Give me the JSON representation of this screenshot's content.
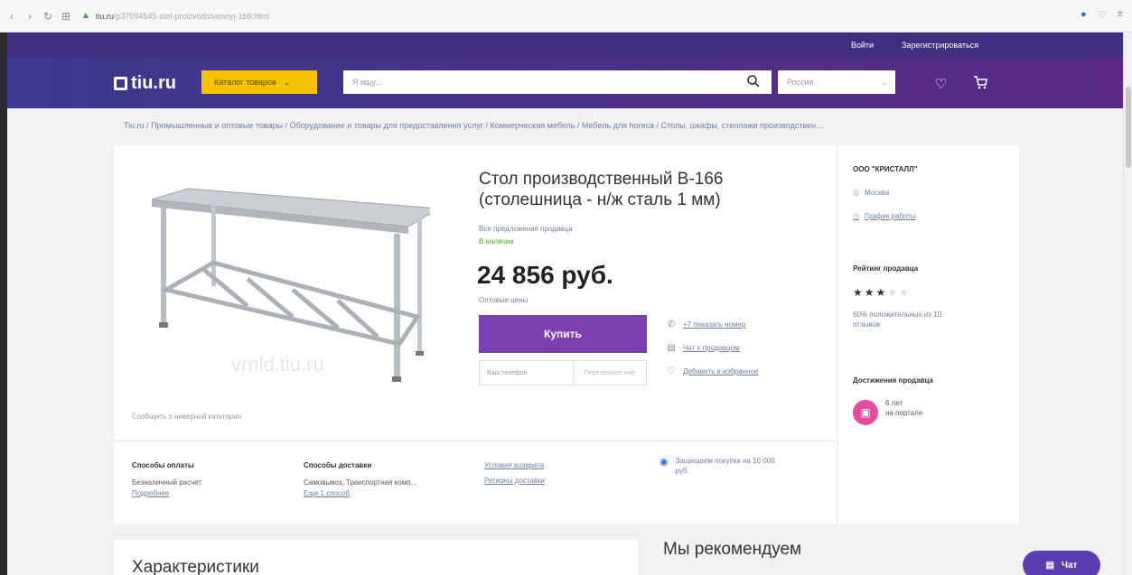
{
  "browser": {
    "url_domain": "tiu.ru",
    "url_rest": "/p37094545-stol-proizvodstvennyj-166.html"
  },
  "header": {
    "login": "Войти",
    "register": "Зарегистрироваться",
    "logo_text": "tiu.ru",
    "catalog_label": "Каталог товаров",
    "search_placeholder": "Я ищу...",
    "region_value": "Россия"
  },
  "breadcrumb": "Tiu.ru / Промышленные и оптовые товары / Оборудование и товары для предоставления услуг / Коммерческая мебель / Мебель для horeca / Столы, шкафы, стеллажи производствен...",
  "product": {
    "title": "Стол производственный В-166 (столешница - н/ж сталь 1 мм)",
    "all_offers": "Все предложения продавца",
    "in_stock": "В наличии",
    "price": "24 856 руб.",
    "wholesale": "Оптовые цены",
    "buy_label": "Купить",
    "phone_placeholder": "Ваш телефон",
    "callback_label": "Перезвоните мне",
    "watermark": "vrnld.tiu.ru",
    "report": "Сообщить о неверной категории",
    "actions": [
      {
        "icon": "phone-icon",
        "label": "+7 показать номер"
      },
      {
        "icon": "chat-icon",
        "label": "Чат с продавцом"
      },
      {
        "icon": "heart-icon",
        "label": "Добавить в избранное"
      }
    ]
  },
  "delivery": {
    "payment_title": "Способы оплаты",
    "payment_text": "Безналичный расчет",
    "payment_more": "Подробнее",
    "shipping_title": "Способы доставки",
    "shipping_text": "Самовывоз, Транспортная комп...",
    "shipping_more": "Еще 1 способ",
    "return_link": "Условия возврата",
    "regions_link": "Регионы доставки",
    "protect_text": "Защищаем покупки на 10 000 руб."
  },
  "seller": {
    "name": "ООО \"КРИСТАЛЛ\"",
    "city": "Москва",
    "schedule": "График работы",
    "rating_title": "Рейтинг продавца",
    "rating": 3,
    "rating_max": 5,
    "positive": "60% положительных из 10 отзывов",
    "achievements_title": "Достижения продавца",
    "years": "6 лет",
    "on_portal": "на портале"
  },
  "sections": {
    "characteristics": "Характеристики",
    "recommend": "Мы рекомендуем",
    "chat_label": "Чат"
  },
  "colors": {
    "brand_purple": "#4d2f86",
    "catalog_yellow": "#f5c400",
    "buy_purple": "#7b3fb0",
    "link_blue": "#6b7fa8",
    "in_stock_green": "#4da52d"
  }
}
